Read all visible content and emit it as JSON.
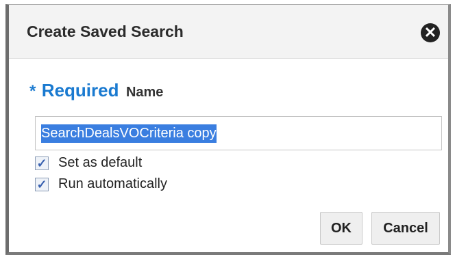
{
  "dialog": {
    "title": "Create Saved Search",
    "close_icon": "close-circle-icon"
  },
  "form": {
    "required_star": "*",
    "required_label": "Required",
    "name_label": "Name",
    "name_value": "SearchDealsVOCriteria copy",
    "options": [
      {
        "label": "Set as default",
        "checked": true
      },
      {
        "label": "Run automatically",
        "checked": true
      }
    ]
  },
  "buttons": {
    "ok_label": "OK",
    "cancel_label": "Cancel"
  },
  "colors": {
    "accent": "#1a7ad0",
    "selection": "#3a7ee0"
  }
}
